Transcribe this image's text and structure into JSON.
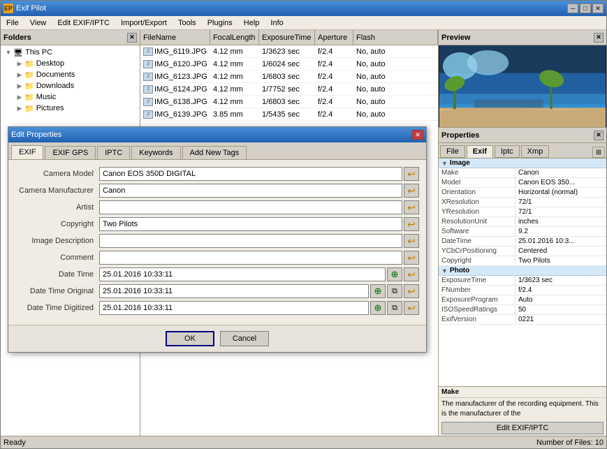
{
  "window": {
    "title": "Exif Pilot",
    "icon": "EP"
  },
  "menu": {
    "items": [
      "File",
      "View",
      "Edit EXIF/IPTC",
      "Import/Export",
      "Tools",
      "Plugins",
      "Help",
      "Info"
    ]
  },
  "folders_panel": {
    "title": "Folders",
    "items": [
      {
        "label": "This PC",
        "level": 0,
        "expanded": true,
        "selected": false
      },
      {
        "label": "Desktop",
        "level": 1,
        "expanded": true,
        "selected": false
      },
      {
        "label": "Documents",
        "level": 1,
        "expanded": false,
        "selected": false
      },
      {
        "label": "Downloads",
        "level": 1,
        "expanded": false,
        "selected": false
      },
      {
        "label": "Music",
        "level": 1,
        "expanded": false,
        "selected": false
      },
      {
        "label": "Pictures",
        "level": 1,
        "expanded": false,
        "selected": false
      }
    ]
  },
  "file_list": {
    "columns": [
      "FileName",
      "FocalLength",
      "ExposureTime",
      "Aperture",
      "Flash"
    ],
    "rows": [
      {
        "filename": "IMG_6119.JPG",
        "focal": "4.12 mm",
        "exposure": "1/3623 sec",
        "aperture": "f/2.4",
        "flash": "No, auto"
      },
      {
        "filename": "IMG_6120.JPG",
        "focal": "4.12 mm",
        "exposure": "1/6024 sec",
        "aperture": "f/2.4",
        "flash": "No, auto"
      },
      {
        "filename": "IMG_6123.JPG",
        "focal": "4.12 mm",
        "exposure": "1/6803 sec",
        "aperture": "f/2.4",
        "flash": "No, auto"
      },
      {
        "filename": "IMG_6124.JPG",
        "focal": "4.12 mm",
        "exposure": "1/7752 sec",
        "aperture": "f/2.4",
        "flash": "No, auto"
      },
      {
        "filename": "IMG_6138.JPG",
        "focal": "4.12 mm",
        "exposure": "1/6803 sec",
        "aperture": "f/2.4",
        "flash": "No, auto"
      },
      {
        "filename": "IMG_6139.JPG",
        "focal": "3.85 mm",
        "exposure": "1/5435 sec",
        "aperture": "f/2.4",
        "flash": "No, auto"
      }
    ]
  },
  "preview": {
    "title": "Preview"
  },
  "properties": {
    "title": "Properties",
    "tabs": [
      "File",
      "Exif",
      "Iptc",
      "Xmp"
    ],
    "active_tab": "Exif",
    "groups": [
      {
        "name": "Image",
        "rows": [
          {
            "label": "Make",
            "value": "Canon"
          },
          {
            "label": "Model",
            "value": "Canon EOS 350..."
          },
          {
            "label": "Orientation",
            "value": "Horizontal (normal)"
          },
          {
            "label": "XResolution",
            "value": "72/1"
          },
          {
            "label": "YResolution",
            "value": "72/1"
          },
          {
            "label": "ResolutionUnit",
            "value": "inches"
          },
          {
            "label": "Software",
            "value": "9.2"
          },
          {
            "label": "DateTime",
            "value": "25.01.2016 10:3..."
          },
          {
            "label": "YCbCrPositioning",
            "value": "Centered"
          },
          {
            "label": "Copyright",
            "value": "Two Pilots"
          }
        ]
      },
      {
        "name": "Photo",
        "rows": [
          {
            "label": "ExposureTime",
            "value": "1/3623 sec"
          },
          {
            "label": "FNumber",
            "value": "f/2.4"
          },
          {
            "label": "ExposureProgram",
            "value": "Auto"
          },
          {
            "label": "ISOSpeedRatings",
            "value": "50"
          },
          {
            "label": "ExifVersion",
            "value": "0221"
          }
        ]
      }
    ],
    "bottom_label": "Make",
    "bottom_text": "The manufacturer of the recording equipment. This is the manufacturer of the",
    "edit_button": "Edit EXIF/IPTC"
  },
  "dialog": {
    "title": "Edit Properties",
    "tabs": [
      "EXIF",
      "EXIF GPS",
      "IPTC",
      "Keywords",
      "Add New Tags"
    ],
    "active_tab": "EXIF",
    "fields": [
      {
        "label": "Camera Model",
        "value": "Canon EOS 350D DIGITAL",
        "has_reset": true,
        "has_copy": false,
        "has_calendar": false
      },
      {
        "label": "Camera Manufacturer",
        "value": "Canon",
        "has_reset": true,
        "has_copy": false,
        "has_calendar": false
      },
      {
        "label": "Artist",
        "value": "",
        "has_reset": true,
        "has_copy": false,
        "has_calendar": false
      },
      {
        "label": "Copyright",
        "value": "Two Pilots",
        "has_reset": true,
        "has_copy": false,
        "has_calendar": false
      },
      {
        "label": "Image Description",
        "value": "",
        "has_reset": true,
        "has_copy": false,
        "has_calendar": false
      },
      {
        "label": "Comment",
        "value": "",
        "has_reset": true,
        "has_copy": false,
        "has_calendar": false
      },
      {
        "label": "Date Time",
        "value": "25.01.2016 10:33:11",
        "has_reset": true,
        "has_copy": false,
        "has_calendar": true
      },
      {
        "label": "Date Time Original",
        "value": "25.01.2016 10:33:11",
        "has_reset": true,
        "has_copy": true,
        "has_calendar": true
      },
      {
        "label": "Date Time Digitized",
        "value": "25.01.2016 10:33:11",
        "has_reset": true,
        "has_copy": true,
        "has_calendar": true
      }
    ],
    "buttons": {
      "ok": "OK",
      "cancel": "Cancel"
    }
  },
  "status_bar": {
    "text": "Ready",
    "file_count": "Number of Files: 10"
  }
}
